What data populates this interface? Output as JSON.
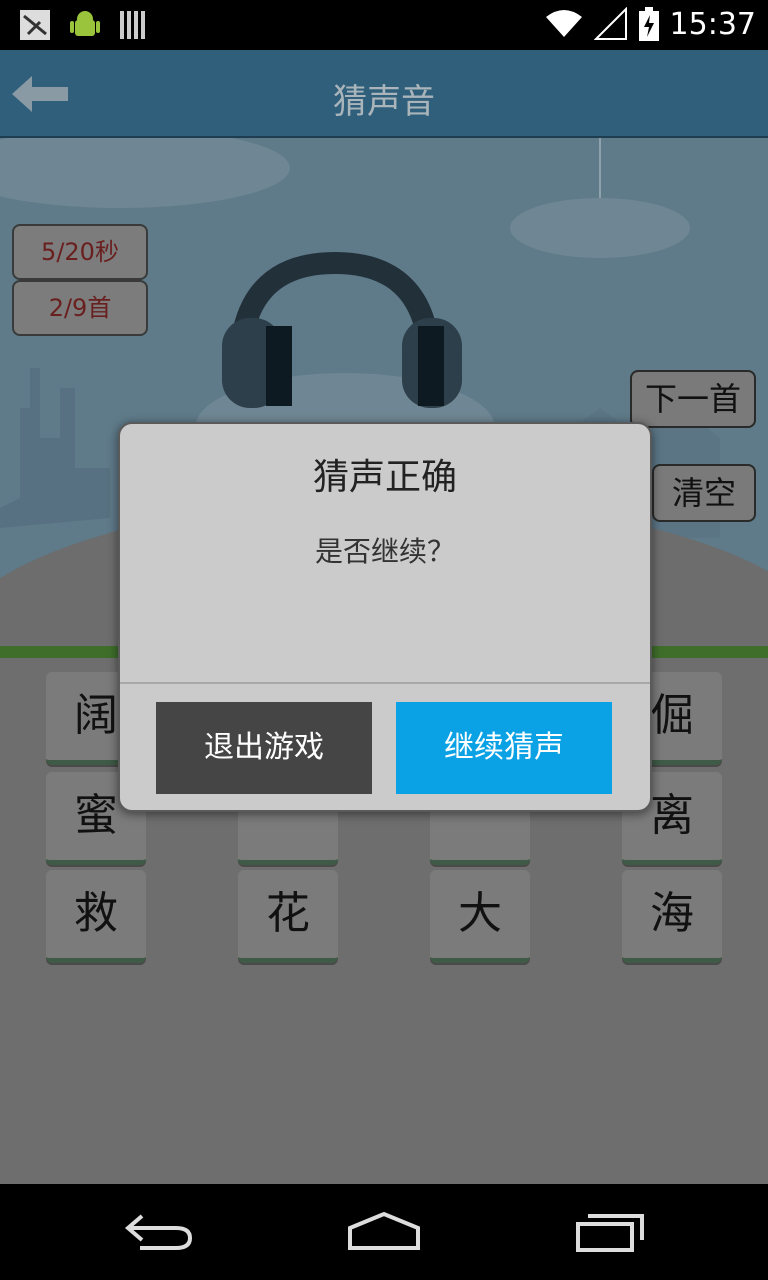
{
  "status_bar": {
    "time": "15:37",
    "icons": [
      "usb-debug-icon",
      "android-icon",
      "storage-icon",
      "wifi-icon",
      "signal-icon",
      "battery-charging-icon"
    ]
  },
  "header": {
    "title": "猜声音",
    "back_icon": "arrow-left-icon"
  },
  "game": {
    "timer": "5/20秒",
    "progress": "2/9首",
    "next_button": "下一首",
    "clear_button": "清空"
  },
  "char_grid": [
    [
      "阔",
      "",
      "",
      "倔"
    ],
    [
      "蜜",
      "",
      "",
      "离"
    ],
    [
      "救",
      "花",
      "大",
      "海"
    ]
  ],
  "dialog": {
    "title": "猜声正确",
    "message": "是否继续？",
    "quit_button": "退出游戏",
    "continue_button": "继续猜声",
    "colors": {
      "quit": "#454545",
      "continue": "#0aa2e4"
    }
  },
  "nav": {
    "icons": [
      "back-nav-icon",
      "home-nav-icon",
      "recents-nav-icon"
    ]
  }
}
